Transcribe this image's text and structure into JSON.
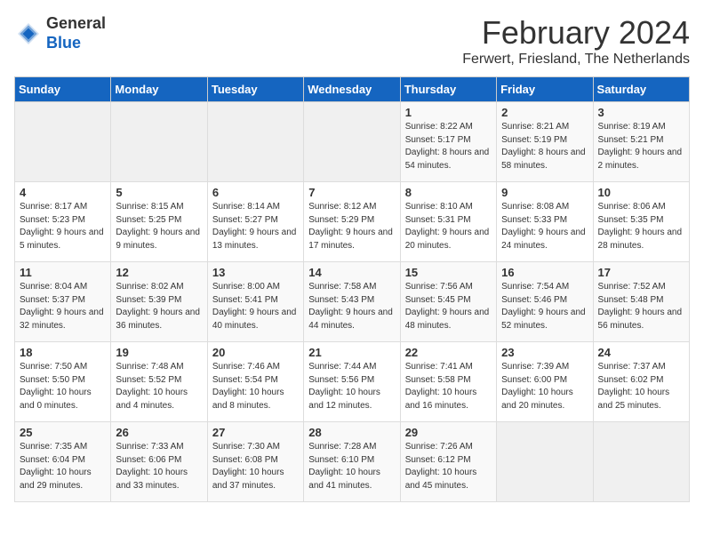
{
  "header": {
    "logo_line1": "General",
    "logo_line2": "Blue",
    "month_year": "February 2024",
    "location": "Ferwert, Friesland, The Netherlands"
  },
  "weekdays": [
    "Sunday",
    "Monday",
    "Tuesday",
    "Wednesday",
    "Thursday",
    "Friday",
    "Saturday"
  ],
  "weeks": [
    [
      {
        "day": "",
        "sunrise": "",
        "sunset": "",
        "daylight": "",
        "empty": true
      },
      {
        "day": "",
        "sunrise": "",
        "sunset": "",
        "daylight": "",
        "empty": true
      },
      {
        "day": "",
        "sunrise": "",
        "sunset": "",
        "daylight": "",
        "empty": true
      },
      {
        "day": "",
        "sunrise": "",
        "sunset": "",
        "daylight": "",
        "empty": true
      },
      {
        "day": "1",
        "sunrise": "Sunrise: 8:22 AM",
        "sunset": "Sunset: 5:17 PM",
        "daylight": "Daylight: 8 hours and 54 minutes."
      },
      {
        "day": "2",
        "sunrise": "Sunrise: 8:21 AM",
        "sunset": "Sunset: 5:19 PM",
        "daylight": "Daylight: 8 hours and 58 minutes."
      },
      {
        "day": "3",
        "sunrise": "Sunrise: 8:19 AM",
        "sunset": "Sunset: 5:21 PM",
        "daylight": "Daylight: 9 hours and 2 minutes."
      }
    ],
    [
      {
        "day": "4",
        "sunrise": "Sunrise: 8:17 AM",
        "sunset": "Sunset: 5:23 PM",
        "daylight": "Daylight: 9 hours and 5 minutes."
      },
      {
        "day": "5",
        "sunrise": "Sunrise: 8:15 AM",
        "sunset": "Sunset: 5:25 PM",
        "daylight": "Daylight: 9 hours and 9 minutes."
      },
      {
        "day": "6",
        "sunrise": "Sunrise: 8:14 AM",
        "sunset": "Sunset: 5:27 PM",
        "daylight": "Daylight: 9 hours and 13 minutes."
      },
      {
        "day": "7",
        "sunrise": "Sunrise: 8:12 AM",
        "sunset": "Sunset: 5:29 PM",
        "daylight": "Daylight: 9 hours and 17 minutes."
      },
      {
        "day": "8",
        "sunrise": "Sunrise: 8:10 AM",
        "sunset": "Sunset: 5:31 PM",
        "daylight": "Daylight: 9 hours and 20 minutes."
      },
      {
        "day": "9",
        "sunrise": "Sunrise: 8:08 AM",
        "sunset": "Sunset: 5:33 PM",
        "daylight": "Daylight: 9 hours and 24 minutes."
      },
      {
        "day": "10",
        "sunrise": "Sunrise: 8:06 AM",
        "sunset": "Sunset: 5:35 PM",
        "daylight": "Daylight: 9 hours and 28 minutes."
      }
    ],
    [
      {
        "day": "11",
        "sunrise": "Sunrise: 8:04 AM",
        "sunset": "Sunset: 5:37 PM",
        "daylight": "Daylight: 9 hours and 32 minutes."
      },
      {
        "day": "12",
        "sunrise": "Sunrise: 8:02 AM",
        "sunset": "Sunset: 5:39 PM",
        "daylight": "Daylight: 9 hours and 36 minutes."
      },
      {
        "day": "13",
        "sunrise": "Sunrise: 8:00 AM",
        "sunset": "Sunset: 5:41 PM",
        "daylight": "Daylight: 9 hours and 40 minutes."
      },
      {
        "day": "14",
        "sunrise": "Sunrise: 7:58 AM",
        "sunset": "Sunset: 5:43 PM",
        "daylight": "Daylight: 9 hours and 44 minutes."
      },
      {
        "day": "15",
        "sunrise": "Sunrise: 7:56 AM",
        "sunset": "Sunset: 5:45 PM",
        "daylight": "Daylight: 9 hours and 48 minutes."
      },
      {
        "day": "16",
        "sunrise": "Sunrise: 7:54 AM",
        "sunset": "Sunset: 5:46 PM",
        "daylight": "Daylight: 9 hours and 52 minutes."
      },
      {
        "day": "17",
        "sunrise": "Sunrise: 7:52 AM",
        "sunset": "Sunset: 5:48 PM",
        "daylight": "Daylight: 9 hours and 56 minutes."
      }
    ],
    [
      {
        "day": "18",
        "sunrise": "Sunrise: 7:50 AM",
        "sunset": "Sunset: 5:50 PM",
        "daylight": "Daylight: 10 hours and 0 minutes."
      },
      {
        "day": "19",
        "sunrise": "Sunrise: 7:48 AM",
        "sunset": "Sunset: 5:52 PM",
        "daylight": "Daylight: 10 hours and 4 minutes."
      },
      {
        "day": "20",
        "sunrise": "Sunrise: 7:46 AM",
        "sunset": "Sunset: 5:54 PM",
        "daylight": "Daylight: 10 hours and 8 minutes."
      },
      {
        "day": "21",
        "sunrise": "Sunrise: 7:44 AM",
        "sunset": "Sunset: 5:56 PM",
        "daylight": "Daylight: 10 hours and 12 minutes."
      },
      {
        "day": "22",
        "sunrise": "Sunrise: 7:41 AM",
        "sunset": "Sunset: 5:58 PM",
        "daylight": "Daylight: 10 hours and 16 minutes."
      },
      {
        "day": "23",
        "sunrise": "Sunrise: 7:39 AM",
        "sunset": "Sunset: 6:00 PM",
        "daylight": "Daylight: 10 hours and 20 minutes."
      },
      {
        "day": "24",
        "sunrise": "Sunrise: 7:37 AM",
        "sunset": "Sunset: 6:02 PM",
        "daylight": "Daylight: 10 hours and 25 minutes."
      }
    ],
    [
      {
        "day": "25",
        "sunrise": "Sunrise: 7:35 AM",
        "sunset": "Sunset: 6:04 PM",
        "daylight": "Daylight: 10 hours and 29 minutes."
      },
      {
        "day": "26",
        "sunrise": "Sunrise: 7:33 AM",
        "sunset": "Sunset: 6:06 PM",
        "daylight": "Daylight: 10 hours and 33 minutes."
      },
      {
        "day": "27",
        "sunrise": "Sunrise: 7:30 AM",
        "sunset": "Sunset: 6:08 PM",
        "daylight": "Daylight: 10 hours and 37 minutes."
      },
      {
        "day": "28",
        "sunrise": "Sunrise: 7:28 AM",
        "sunset": "Sunset: 6:10 PM",
        "daylight": "Daylight: 10 hours and 41 minutes."
      },
      {
        "day": "29",
        "sunrise": "Sunrise: 7:26 AM",
        "sunset": "Sunset: 6:12 PM",
        "daylight": "Daylight: 10 hours and 45 minutes."
      },
      {
        "day": "",
        "sunrise": "",
        "sunset": "",
        "daylight": "",
        "empty": true
      },
      {
        "day": "",
        "sunrise": "",
        "sunset": "",
        "daylight": "",
        "empty": true
      }
    ]
  ]
}
